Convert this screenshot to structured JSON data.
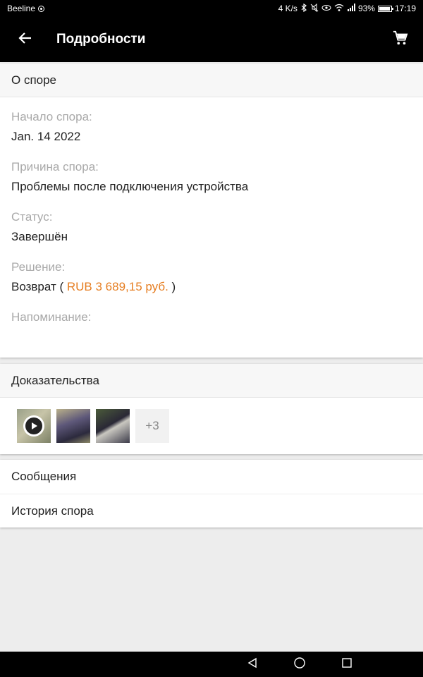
{
  "status_bar": {
    "carrier": "Beeline",
    "net_speed": "4 K/s",
    "battery": "93%",
    "time": "17:19"
  },
  "app_bar": {
    "title": "Подробности",
    "back_icon": "arrow-back-icon",
    "cart_icon": "cart-icon"
  },
  "dispute": {
    "header": "О споре",
    "fields": [
      {
        "label": "Начало спора:",
        "value": "Jan. 14 2022"
      },
      {
        "label": "Причина спора:",
        "value": "Проблемы после подключения устройства"
      },
      {
        "label": "Статус:",
        "value": "Завершён"
      }
    ],
    "resolution": {
      "label": "Решение:",
      "prefix": "Возврат (",
      "amount": "RUB 3 689,15 руб.",
      "suffix": ")",
      "amount_color": "#e67e22"
    },
    "reminder": {
      "label": "Напоминание:",
      "value": ""
    }
  },
  "evidence": {
    "header": "Доказательства",
    "more_count": "+3"
  },
  "links": {
    "messages": "Сообщения",
    "history": "История спора"
  },
  "colors": {
    "app_bar": "#000000",
    "accent_orange": "#e67e22",
    "label_gray": "#a9a9a9"
  }
}
